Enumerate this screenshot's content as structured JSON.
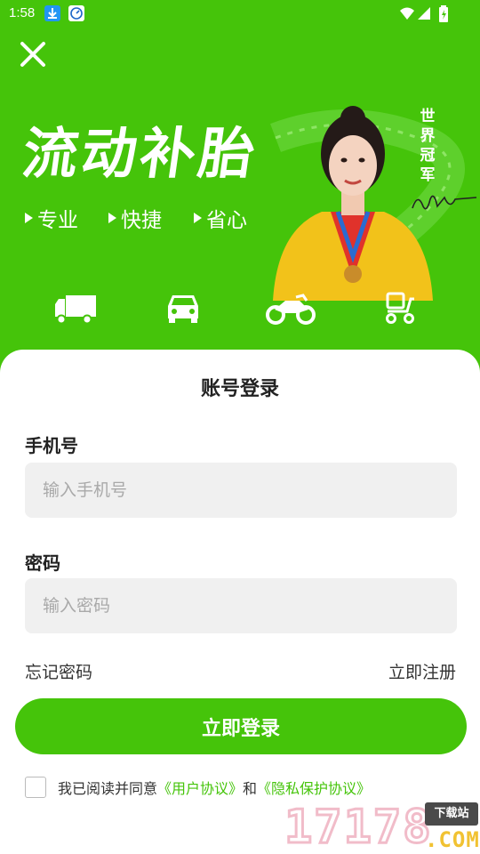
{
  "status_bar": {
    "time": "1:58"
  },
  "header": {
    "title": "流动补胎",
    "taglines": [
      "专业",
      "快捷",
      "省心"
    ],
    "champion_text": [
      "世",
      "界",
      "冠",
      "军"
    ]
  },
  "vehicles": [
    {
      "icon": "truck-icon"
    },
    {
      "icon": "car-icon"
    },
    {
      "icon": "motorcycle-icon"
    },
    {
      "icon": "scooter-icon"
    }
  ],
  "login": {
    "title": "账号登录",
    "phone_label": "手机号",
    "phone_placeholder": "输入手机号",
    "password_label": "密码",
    "password_placeholder": "输入密码",
    "forgot_label": "忘记密码",
    "register_label": "立即注册",
    "submit_label": "立即登录",
    "agree_prefix": "我已阅读并同意",
    "user_agreement": "《用户协议》",
    "agree_and": "和",
    "privacy_agreement": "《隐私保护协议》"
  },
  "watermark": {
    "digits": "17178",
    "badge": "下载站",
    "suffix": ".COM"
  },
  "colors": {
    "brand_green": "#45c40a",
    "input_bg": "#f0f0f0"
  }
}
